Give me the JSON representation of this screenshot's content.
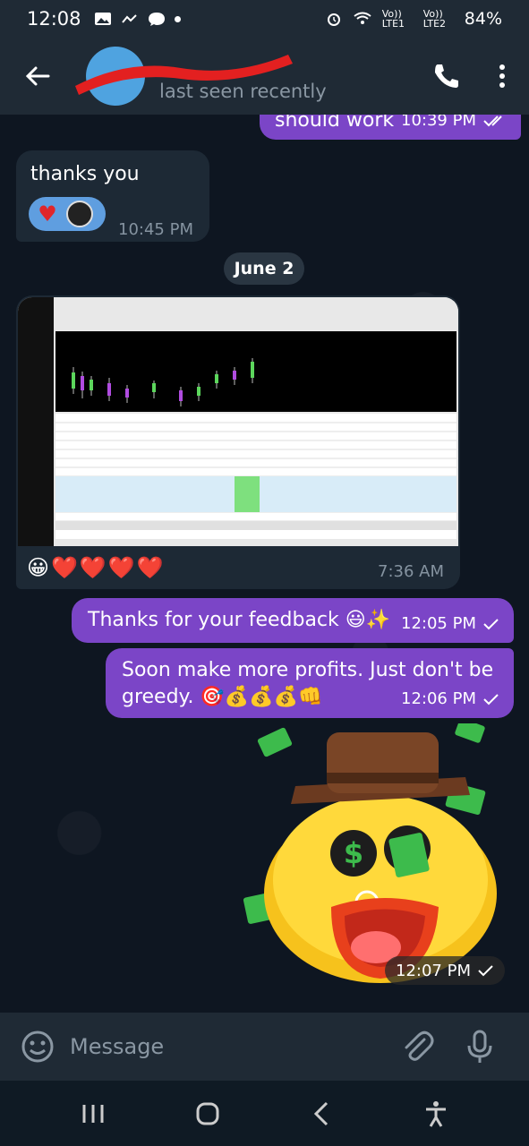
{
  "status_bar": {
    "time": "12:08",
    "battery": "84%",
    "sim1": "Vo)) LTE1",
    "sim2": "Vo)) LTE2"
  },
  "header": {
    "subtitle": "last seen recently"
  },
  "messages": [
    {
      "id": "m1",
      "direction": "out",
      "text": "should work",
      "time": "10:39 PM",
      "status": "read"
    },
    {
      "id": "m2",
      "direction": "in",
      "text": "thanks you",
      "time": "10:45 PM"
    },
    {
      "id": "m3",
      "direction": "in",
      "text": "😀❤️❤️❤️❤️",
      "time": "7:36 AM"
    },
    {
      "id": "m4",
      "direction": "out",
      "text": "Thanks for your feedback 😃✨",
      "time": "12:05 PM",
      "status": "sent"
    },
    {
      "id": "m5",
      "direction": "out",
      "text": "Soon make more profits. Just don't be greedy. 🎯💰💰💰👊",
      "time": "12:06 PM",
      "status": "sent"
    },
    {
      "id": "m6",
      "direction": "out",
      "type": "sticker",
      "time": "12:07 PM",
      "status": "sent"
    }
  ],
  "date_separator": "June 2",
  "input": {
    "placeholder": "Message"
  },
  "colors": {
    "outgoing_bubble": "#7b45c7",
    "incoming_bubble": "#1d2935",
    "header_bg": "#1f2a35",
    "chat_bg": "#0e1621",
    "reaction_pill": "#5f9ee0"
  }
}
